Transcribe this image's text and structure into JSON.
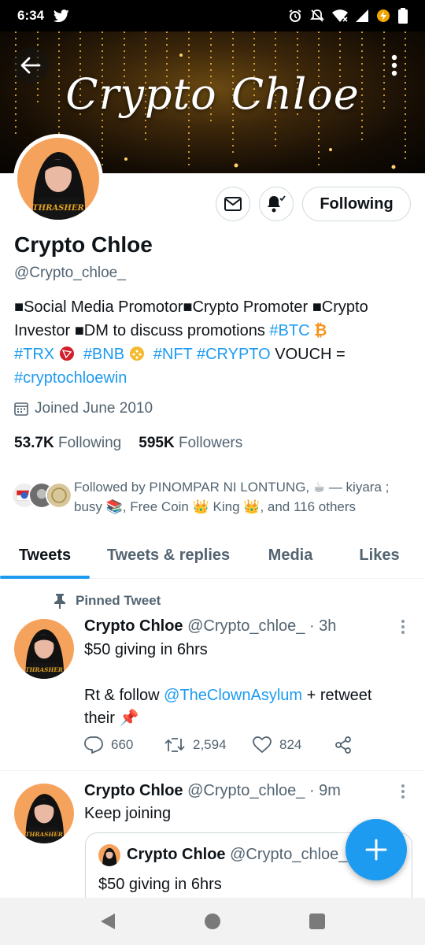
{
  "status_bar": {
    "time": "6:34",
    "icons": [
      "twitter-icon",
      "alarm-icon",
      "mute-icon",
      "wifi-icon",
      "signal-icon",
      "battery-saver-icon",
      "battery-icon"
    ]
  },
  "banner": {
    "title": "Crypto Chloe"
  },
  "profile": {
    "name": "Crypto Chloe",
    "handle": "@Crypto_chloe_",
    "following_button": "Following",
    "bio": {
      "seg1": "■Social Media Promotor■Crypto Promoter ■Crypto Investor ■DM to discuss promotions ",
      "tag_btc": "#BTC",
      "emoji_btc": "₿",
      "tag_trx": "#TRX",
      "tag_bnb": "#BNB",
      "tag_nft": "#NFT",
      "tag_crypto": "#CRYPTO",
      "seg_vouch": " VOUCH = ",
      "tag_win": "#cryptochloewin"
    },
    "joined": "Joined June 2010",
    "following_count": "53.7K",
    "following_label": "Following",
    "followers_count": "595K",
    "followers_label": "Followers",
    "followed_by": {
      "line1": "Followed by PINOMPAR NI LONTUNG, ☕ — kiyara ;",
      "line2_a": "busy 📚, Free Coin ",
      "line2_b": " King ",
      "line2_c": ", and 116 others"
    }
  },
  "tabs": [
    "Tweets",
    "Tweets & replies",
    "Media",
    "Likes"
  ],
  "tweets": [
    {
      "pinned_label": "Pinned Tweet",
      "name": "Crypto Chloe",
      "handle": "@Crypto_chloe_",
      "time": "· 3h",
      "line1": "$50 giving in 6hrs",
      "line2_a": "Rt & follow ",
      "line2_mention": "@TheClownAsylum",
      "line2_b": " + retweet",
      "line3": "their 📌",
      "replies": "660",
      "retweets": "2,594",
      "likes": "824"
    },
    {
      "name": "Crypto Chloe",
      "handle": "@Crypto_chloe_",
      "time": "· 9m",
      "text": "Keep joining",
      "quote": {
        "name": "Crypto Chloe",
        "handle": "@Crypto_chloe_",
        "text": "$50 giving in 6hrs"
      }
    }
  ],
  "colors": {
    "accent": "#1d9bf0",
    "text": "#0f1419",
    "muted": "#536471"
  }
}
